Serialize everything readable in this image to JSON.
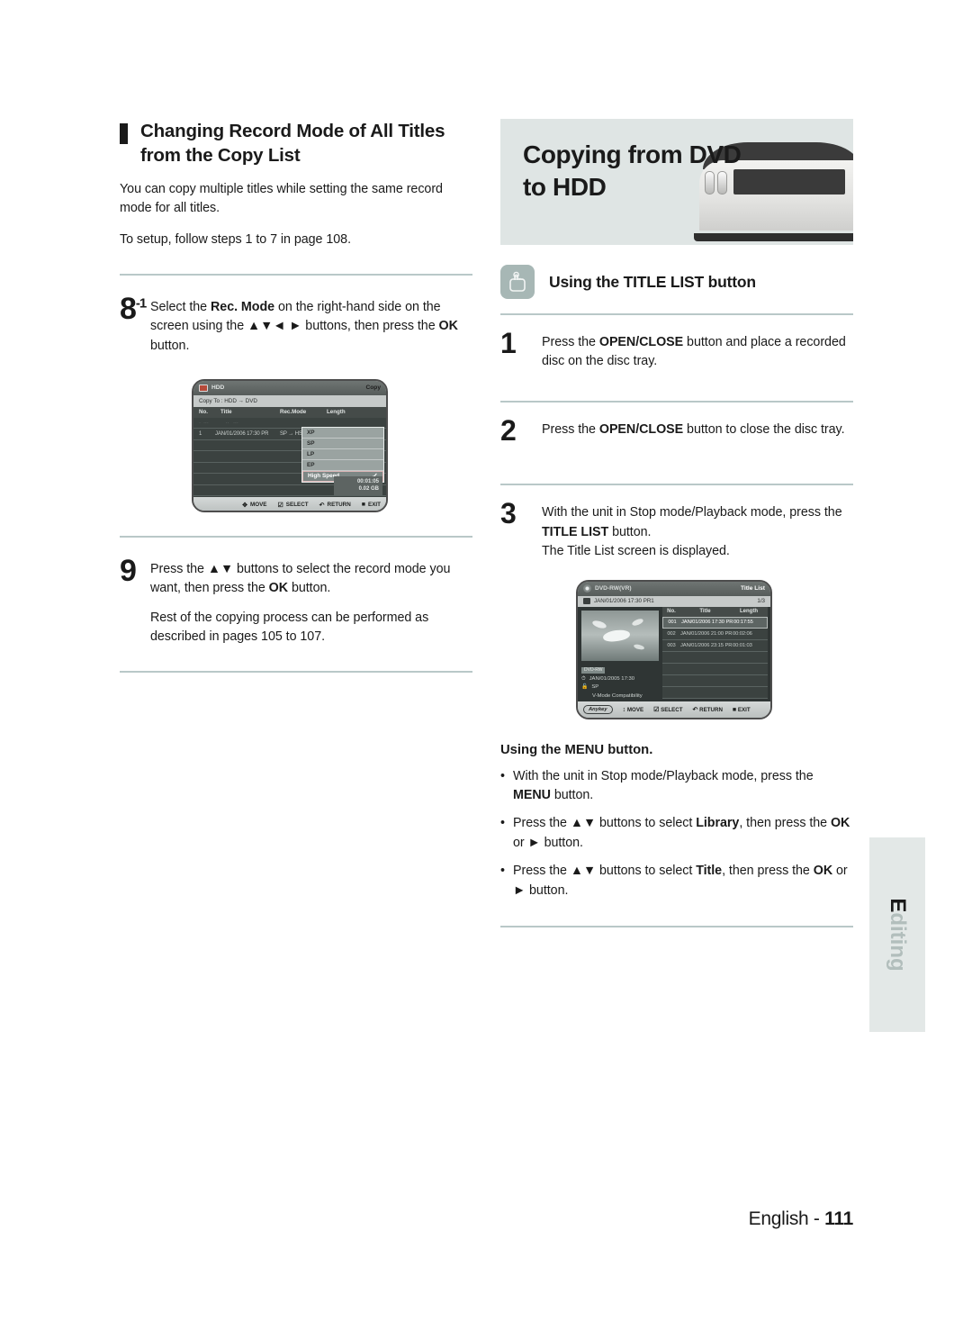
{
  "left": {
    "section_title": "Changing Record Mode of All Titles from the Copy List",
    "intro": "You can copy multiple titles while setting the same record mode for all titles.",
    "setup_note": "To setup, follow steps 1 to 7 in page 108.",
    "step8": {
      "number": "8",
      "sup": "-1",
      "line1_a": "Select the ",
      "line1_b": "Rec. Mode",
      "line1_c": " on the right-hand side on the screen using the ",
      "line1_d": "▲▼◄ ►",
      "line1_e": " buttons, then press the ",
      "line1_f": "OK",
      "line1_g": " button."
    },
    "step9": {
      "number": "9",
      "a": "Press the ",
      "b": "▲▼",
      "c": " buttons to select the record mode you want, then press the ",
      "d": "OK",
      "e": " button.",
      "sub": "Rest of the copying process can be performed as described in pages 105 to 107."
    },
    "copy_screen": {
      "device_label": "HDD",
      "mode_label": "Copy",
      "copy_to": "Copy To : HDD  →  DVD",
      "columns": [
        "No.",
        "Title",
        "Rec.Mode",
        "Length"
      ],
      "row": {
        "no": "1",
        "title": "JAN/01/2006 17:30 PR",
        "rec_mode": "SP → HS",
        "length": "01:"
      },
      "dropdown": {
        "items": [
          "XP",
          "SP",
          "LP",
          "EP",
          "High Speed"
        ],
        "selected": "High Speed",
        "check": "✓"
      },
      "size_time": "00:01:05",
      "size_gb": "0.02 GB",
      "footer": [
        {
          "glyph": "✥",
          "label": "MOVE"
        },
        {
          "glyph": "☑",
          "label": "SELECT"
        },
        {
          "glyph": "↶",
          "label": "RETURN"
        },
        {
          "glyph": "■",
          "label": "EXIT"
        }
      ]
    }
  },
  "right": {
    "banner_title": "Copying from DVD to HDD",
    "subhead": "Using the TITLE LIST button",
    "subhead_icon": "hand-press-button-icon",
    "steps": [
      {
        "number": "1",
        "a": "Press the ",
        "b": "OPEN/CLOSE",
        "c": " button and place a recorded disc on the disc tray."
      },
      {
        "number": "2",
        "a": "Press the ",
        "b": "OPEN/CLOSE",
        "c": " button to close the disc tray."
      },
      {
        "number": "3",
        "a": "With the unit in Stop mode/Playback mode, press the ",
        "b": "TITLE LIST",
        "c": " button.",
        "sub": "The Title List screen is displayed."
      }
    ],
    "title_list_screen": {
      "disc_type": "DVD-RW(VR)",
      "screen_name": "Title List",
      "current_title": "JAN/01/2006 17:30 PR1",
      "page_indicator": "1/3",
      "columns": [
        "No.",
        "Title",
        "Length"
      ],
      "rows": [
        {
          "no": "001",
          "title": "JAN/01/2006 17:30 PR",
          "length": "00:17:55"
        },
        {
          "no": "002",
          "title": "JAN/01/2006 21:00 PR",
          "length": "00:02:06"
        },
        {
          "no": "003",
          "title": "JAN/01/2006 23:15 PR",
          "length": "00:01:03"
        }
      ],
      "info_badge": "DVD-RW",
      "info_date": "JAN/01/2005 17:30",
      "info_mode": "SP",
      "info_note": "V-Mode Compatibility",
      "footer_anykey": "Anykey",
      "footer": [
        {
          "glyph": "↕",
          "label": "MOVE"
        },
        {
          "glyph": "☑",
          "label": "SELECT"
        },
        {
          "glyph": "↶",
          "label": "RETURN"
        },
        {
          "glyph": "■",
          "label": "EXIT"
        }
      ]
    },
    "menu_block": {
      "title": "Using the MENU button.",
      "bullets": [
        {
          "a": "With the unit in Stop mode/Playback mode, press the ",
          "b": "MENU",
          "c": " button."
        },
        {
          "a": "Press the ",
          "arrows": "▲▼",
          "b": " buttons to select ",
          "bold1": "Library",
          "c": ", then press the ",
          "bold2": "OK",
          "d": " or ",
          "arrow2": "►",
          "e": " button."
        },
        {
          "a": "Press the ",
          "arrows": "▲▼",
          "b": " buttons to select ",
          "bold1": "Title",
          "c": ", then press the ",
          "bold2": "OK",
          "d": " or ",
          "arrow2": "►",
          "e": " button."
        }
      ]
    }
  },
  "side_tab": {
    "label_first": "E",
    "label_rest": "diting"
  },
  "footer": {
    "language": "English - ",
    "page": "111"
  },
  "colors": {
    "rule": "#b9c8c8",
    "banner_bg": "#dfe5e4",
    "icon_bg": "#a7b7b5",
    "side_tab_bg": "#e3e8e7",
    "side_tab_text": "#b2bebc"
  }
}
